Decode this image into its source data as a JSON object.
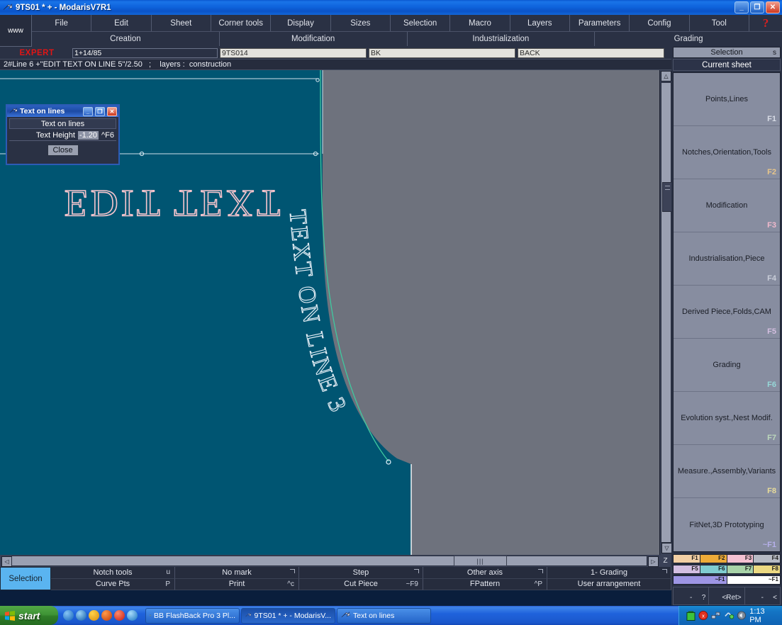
{
  "window": {
    "title": "9TS01 * + - ModarisV7R1",
    "minimize": "_",
    "maximize": "❐",
    "close": "✕"
  },
  "menu": {
    "www": "www",
    "items": [
      "File",
      "Edit",
      "Sheet",
      "Corner tools",
      "Display",
      "Sizes",
      "Selection",
      "Macro",
      "Layers",
      "Parameters",
      "Config",
      "Tool"
    ],
    "help": "?",
    "modes": [
      "Creation",
      "Modification",
      "Industrialization",
      "Grading"
    ]
  },
  "fields": {
    "expert": "EXPERT",
    "size": "1+14/85",
    "model": "9TS014",
    "code": "BK",
    "name": "BACK"
  },
  "status": {
    "line": "2#Line 6 +\"EDIT TEXT ON LINE 5\"/2.50   ;    layers :  construction"
  },
  "canvas": {
    "background_gray": "#6e727d",
    "piece_fill": "#005572",
    "pink_text": "EDIT TEXT",
    "curve_text": "TEXT ON LINE 3",
    "curve_color": "#3fc9a0",
    "outline_color": "#ffffff"
  },
  "scrollbars": {
    "left_arrow": "◁",
    "right_arrow": "▷",
    "up_arrow": "△",
    "down_arrow": "▽",
    "z_button": "Z",
    "thumb_grip": "|||"
  },
  "bottom_toolbar": {
    "selection": "Selection",
    "rows": [
      [
        {
          "label": "Notch tools",
          "key": "u",
          "corner": false
        },
        {
          "label": "No mark",
          "key": "",
          "corner": true
        },
        {
          "label": "Step",
          "key": "",
          "corner": true
        },
        {
          "label": "Other axis",
          "key": "",
          "corner": true
        },
        {
          "label": "1- Grading",
          "key": "",
          "corner": true
        }
      ],
      [
        {
          "label": "Curve Pts",
          "key": "P",
          "corner": false
        },
        {
          "label": "Print",
          "key": "^c",
          "corner": false
        },
        {
          "label": "Cut Piece",
          "key": "~F9",
          "corner": false
        },
        {
          "label": "FPattern",
          "key": "^P",
          "corner": false
        },
        {
          "label": "User arrangement",
          "key": "",
          "corner": false
        }
      ]
    ]
  },
  "sidebar": {
    "header": {
      "label": "Selection",
      "key": "s"
    },
    "subheader": "Current sheet",
    "fbuttons": [
      {
        "label": "Points,Lines",
        "key": "F1",
        "key_color": "#d8dce6"
      },
      {
        "label": "Notches,Orientation,Tools",
        "key": "F2",
        "key_color": "#e8c68a"
      },
      {
        "label": "Modification",
        "key": "F3",
        "key_color": "#f0b9cc"
      },
      {
        "label": "Industrialisation,Piece",
        "key": "F4",
        "key_color": "#c9ced9"
      },
      {
        "label": "Derived Piece,Folds,CAM",
        "key": "F5",
        "key_color": "#d4bfe0"
      },
      {
        "label": "Grading",
        "key": "F6",
        "key_color": "#96d8d8"
      },
      {
        "label": "Evolution syst.,Nest Modif.",
        "key": "F7",
        "key_color": "#bcd9bc"
      },
      {
        "label": "Measure.,Assembly,Variants",
        "key": "F8",
        "key_color": "#e8dc9a"
      },
      {
        "label": "FitNet,3D Prototyping",
        "key": "~F1",
        "key_color": "#b6b0ea"
      }
    ],
    "swatch_rows": [
      [
        {
          "label": "F1",
          "color": "#f2cfa4"
        },
        {
          "label": "F2",
          "color": "#eeab38"
        },
        {
          "label": "F3",
          "color": "#f4c1d2"
        },
        {
          "label": "F4",
          "color": "#b6bac4"
        }
      ],
      [
        {
          "label": "F5",
          "color": "#d3bfe2"
        },
        {
          "label": "F6",
          "color": "#7fccd0"
        },
        {
          "label": "F7",
          "color": "#a8d3a8"
        },
        {
          "label": "F8",
          "color": "#ecd982"
        }
      ],
      [
        {
          "label": "~F1",
          "color": "#9d95e4"
        },
        {
          "label": "~F1",
          "color": "#ffffff"
        }
      ]
    ],
    "bottom_buttons": [
      {
        "left": "-",
        "right": "?"
      },
      {
        "left": "-",
        "right": "<Ret>"
      },
      {
        "left": "-",
        "right": "<"
      }
    ]
  },
  "dialog": {
    "title": "Text on lines",
    "minimize": "_",
    "maximize": "❐",
    "close": "✕",
    "header_row": "Text on lines",
    "field_label": "Text Height",
    "field_value": "-1.20",
    "field_key": "^F6",
    "close_button": "Close"
  },
  "taskbar": {
    "start": "start",
    "tasks": [
      {
        "label": "BB FlashBack Pro 3 Pl...",
        "active": false
      },
      {
        "label": "9TS01 * + - ModarisV...",
        "active": true
      },
      {
        "label": "Text on lines",
        "active": false
      }
    ],
    "clock": "1:13 PM"
  }
}
